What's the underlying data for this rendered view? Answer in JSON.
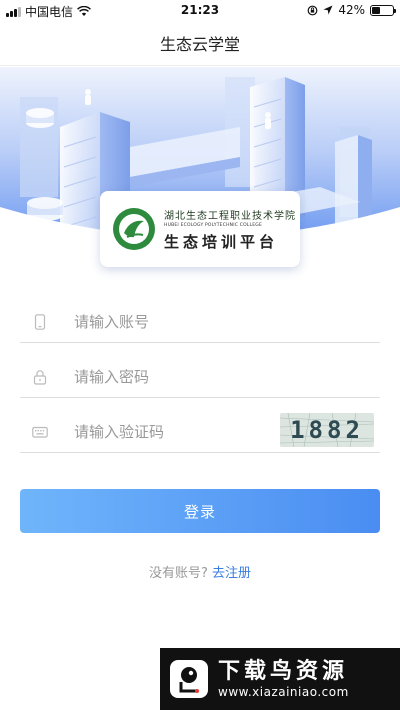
{
  "status_bar": {
    "carrier": "中国电信",
    "time": "21:23",
    "battery": "42%",
    "battery_level": 0.42
  },
  "nav": {
    "title": "生态云学堂"
  },
  "logo": {
    "college_cn": "湖北生态工程职业技术学院",
    "college_en": "HUBEI ECOLOGY POLYTECHNIC COLLEGE",
    "subtitle": "生态培训平台",
    "emblem_icon": "college-emblem"
  },
  "form": {
    "account": {
      "placeholder": "请输入账号",
      "value": "",
      "icon": "phone-icon"
    },
    "password": {
      "placeholder": "请输入密码",
      "value": "",
      "icon": "lock-icon"
    },
    "captcha": {
      "placeholder": "请输入验证码",
      "value": "",
      "icon": "keyboard-icon",
      "code": "1882"
    }
  },
  "login_button": {
    "label": "登录"
  },
  "register": {
    "prompt": "没有账号?",
    "link": "去注册"
  },
  "watermark": {
    "title": "下载鸟资源",
    "url": "www.xiazainiao.com"
  },
  "colors": {
    "accent": "#4a8df2",
    "hero_bg": "#5b8ef0",
    "link": "#3b7de0",
    "emblem_green": "#2e8b3e"
  }
}
